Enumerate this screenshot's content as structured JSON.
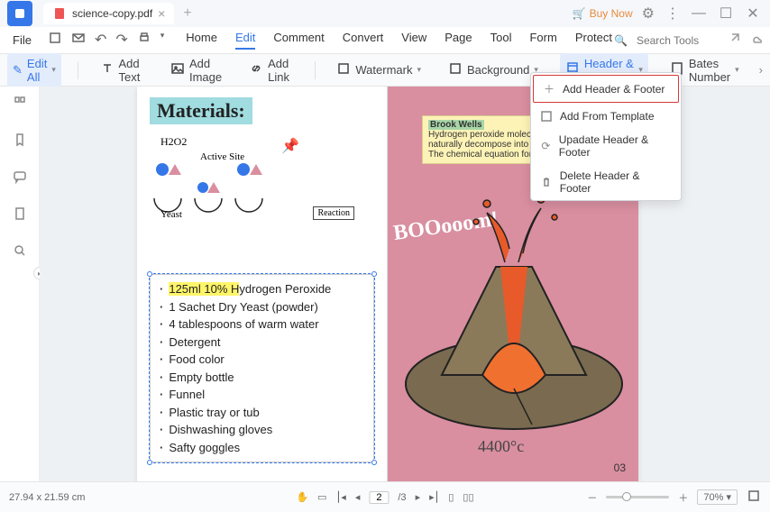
{
  "titlebar": {
    "filename": "science-copy.pdf",
    "buy_now": "Buy Now"
  },
  "menubar": {
    "file": "File",
    "tabs": [
      "Home",
      "Edit",
      "Comment",
      "Convert",
      "View",
      "Page",
      "Tool",
      "Form",
      "Protect"
    ],
    "active_tab": "Edit",
    "search_placeholder": "Search Tools"
  },
  "toolbar": {
    "edit_all": "Edit All",
    "add_text": "Add Text",
    "add_image": "Add Image",
    "add_link": "Add Link",
    "watermark": "Watermark",
    "background": "Background",
    "header_footer": "Header & Footer",
    "bates_number": "Bates Number"
  },
  "dropdown": {
    "items": [
      "Add Header & Footer",
      "Add From Template",
      "Upadate Header & Footer",
      "Delete Header & Footer"
    ]
  },
  "page_left": {
    "heading": "Materials:",
    "h2o2": "H2O2",
    "active_site": "Active Site",
    "yeast": "Yeast",
    "reaction": "Reaction",
    "list": [
      {
        "text_hl": "125ml 10% H",
        "text_rest": "ydrogen Peroxide"
      },
      {
        "text": "1 Sachet Dry Yeast (powder)"
      },
      {
        "text": "4 tablespoons of warm water"
      },
      {
        "text": "Detergent"
      },
      {
        "text": "Food color"
      },
      {
        "text": "Empty bottle"
      },
      {
        "text": "Funnel"
      },
      {
        "text": "Plastic tray or tub"
      },
      {
        "text": "Dishwashing gloves"
      },
      {
        "text": "Safty goggles"
      }
    ]
  },
  "page_right": {
    "note_author": "Brook Wells",
    "note_line1": "Hydrogen peroxide molecules a",
    "note_line2": "naturally decompose into water a",
    "note_line3": "The chemical equation for this decomposition is:",
    "boom": "BOOooom!",
    "temp": "4400°c",
    "page_num": "03"
  },
  "statusbar": {
    "dimensions": "27.94 x 21.59 cm",
    "page_current": "2",
    "page_total": "/3",
    "zoom": "70%"
  }
}
